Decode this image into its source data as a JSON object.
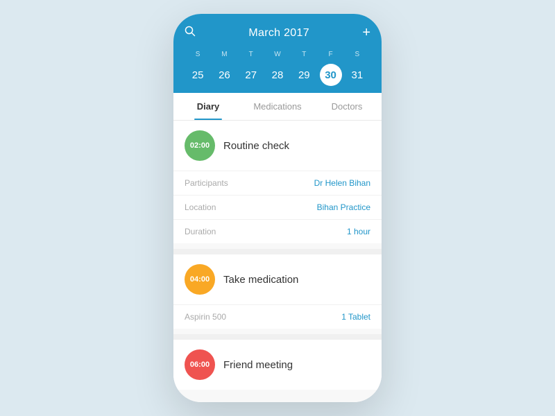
{
  "calendar": {
    "title": "March 2017",
    "day_labels": [
      "S",
      "M",
      "T",
      "W",
      "T",
      "F",
      "S"
    ],
    "dates": [
      "25",
      "26",
      "27",
      "28",
      "29",
      "30",
      "31"
    ],
    "selected_date": "30"
  },
  "tabs": [
    {
      "id": "diary",
      "label": "Diary",
      "active": true
    },
    {
      "id": "medications",
      "label": "Medications",
      "active": false
    },
    {
      "id": "doctors",
      "label": "Doctors",
      "active": false
    }
  ],
  "events": [
    {
      "time": "02:00",
      "badge_color": "green",
      "title": "Routine check",
      "details": [
        {
          "label": "Participants",
          "value": "Dr Helen Bihan"
        },
        {
          "label": "Location",
          "value": "Bihan Practice"
        },
        {
          "label": "Duration",
          "value": "1 hour"
        }
      ]
    },
    {
      "time": "04:00",
      "badge_color": "yellow",
      "title": "Take medication",
      "details": [
        {
          "label": "Aspirin 500",
          "value": "1 Tablet"
        }
      ]
    },
    {
      "time": "06:00",
      "badge_color": "red",
      "title": "Friend meeting",
      "details": []
    }
  ],
  "icons": {
    "search": "&#9906;",
    "plus": "+"
  }
}
